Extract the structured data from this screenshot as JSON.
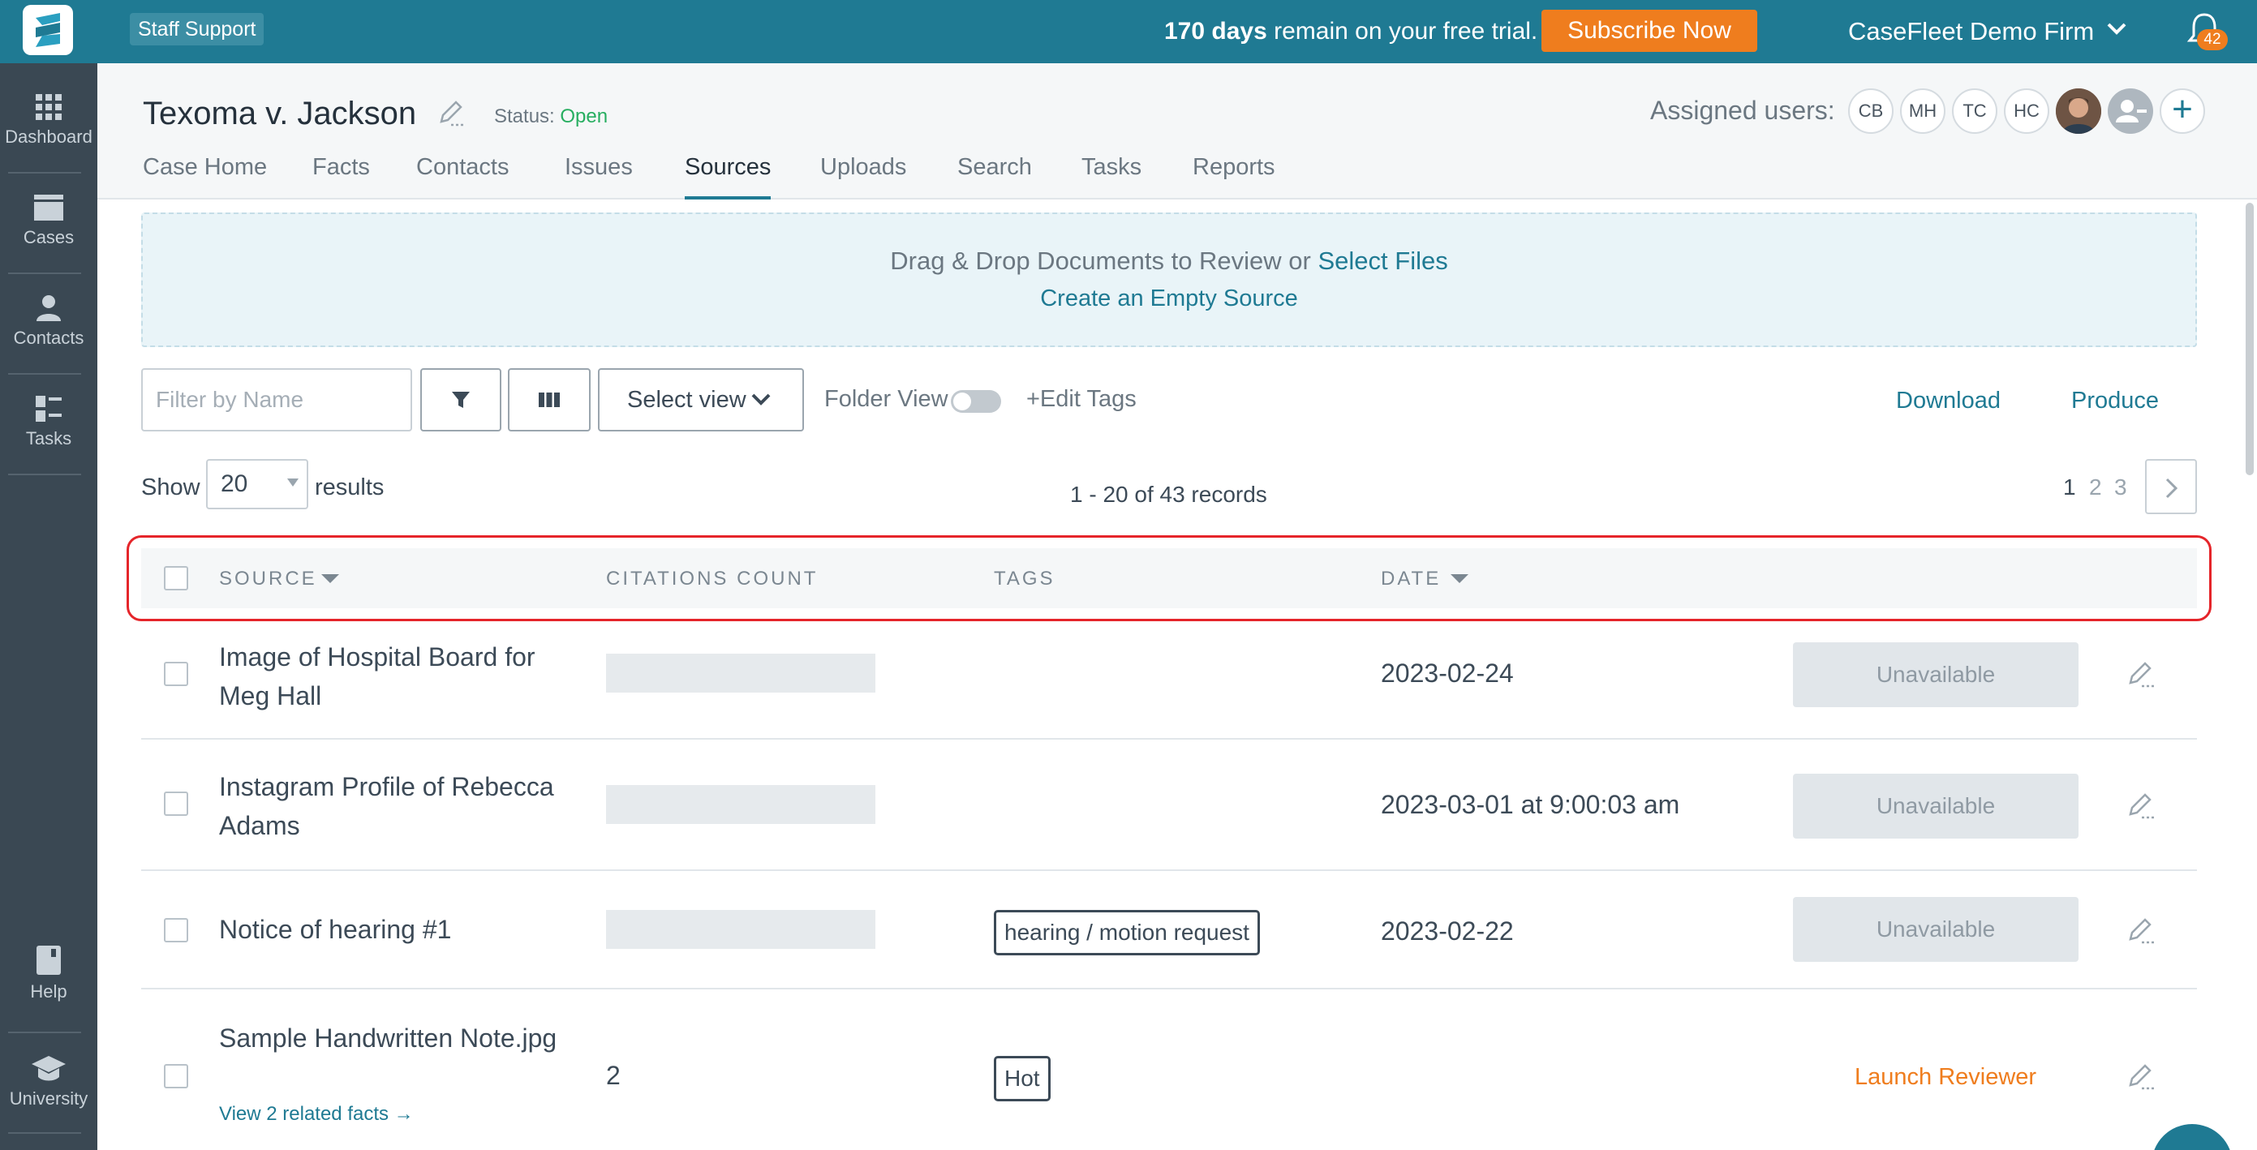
{
  "topbar": {
    "staff_support": "Staff Support",
    "trial_days": "170 days",
    "trial_rest": " remain on your free trial.",
    "subscribe": "Subscribe Now",
    "firm": "CaseFleet Demo Firm",
    "notifications": "42",
    "brand_color": "#1f7a93",
    "accent_color": "#ef7d1e"
  },
  "sidebar": {
    "items": [
      {
        "label": "Dashboard",
        "icon": "grid-icon"
      },
      {
        "label": "Cases",
        "icon": "folder-icon"
      },
      {
        "label": "Contacts",
        "icon": "person-icon"
      },
      {
        "label": "Tasks",
        "icon": "tasks-icon"
      },
      {
        "label": "Help",
        "icon": "book-icon"
      },
      {
        "label": "University",
        "icon": "graduation-cap-icon"
      }
    ]
  },
  "case": {
    "title": "Texoma v. Jackson",
    "status_label": "Status: ",
    "status_value": "Open",
    "assigned_label": "Assigned users:",
    "users": [
      "CB",
      "MH",
      "TC",
      "HC"
    ],
    "add_user": "+"
  },
  "tabs": [
    "Case Home",
    "Facts",
    "Contacts",
    "Issues",
    "Sources",
    "Uploads",
    "Search",
    "Tasks",
    "Reports"
  ],
  "active_tab": "Sources",
  "dropzone": {
    "text": "Drag & Drop Documents to Review or ",
    "select_files": "Select Files",
    "create_empty": "Create an Empty Source"
  },
  "toolbar": {
    "filter_placeholder": "Filter by Name",
    "select_view": "Select view",
    "folder_view": "Folder View",
    "edit_tags": "+Edit Tags",
    "download": "Download",
    "produce": "Produce"
  },
  "pagination": {
    "show": "Show",
    "per_page": "20",
    "results": "results",
    "records": "1 - 20 of 43 records",
    "pages": [
      "1",
      "2",
      "3"
    ],
    "current_page": "1"
  },
  "table": {
    "headers": [
      "SOURCE",
      "CITATIONS COUNT",
      "TAGS",
      "DATE"
    ],
    "rows": [
      {
        "source": "Image of Hospital Board for Meg Hall",
        "citations": "",
        "tag": "",
        "date": "2023-02-24",
        "action": "Unavailable",
        "related": ""
      },
      {
        "source": "Instagram Profile of Rebecca Adams",
        "citations": "",
        "tag": "",
        "date": "2023-03-01 at 9:00:03 am",
        "action": "Unavailable",
        "related": ""
      },
      {
        "source": "Notice of hearing #1",
        "citations": "",
        "tag": "hearing / motion request",
        "date": "2023-02-22",
        "action": "Unavailable",
        "related": ""
      },
      {
        "source": "Sample Handwritten Note.jpg",
        "citations": "2",
        "tag": "Hot",
        "date": "",
        "action": "Launch Reviewer",
        "related": "View 2 related facts →"
      }
    ]
  }
}
